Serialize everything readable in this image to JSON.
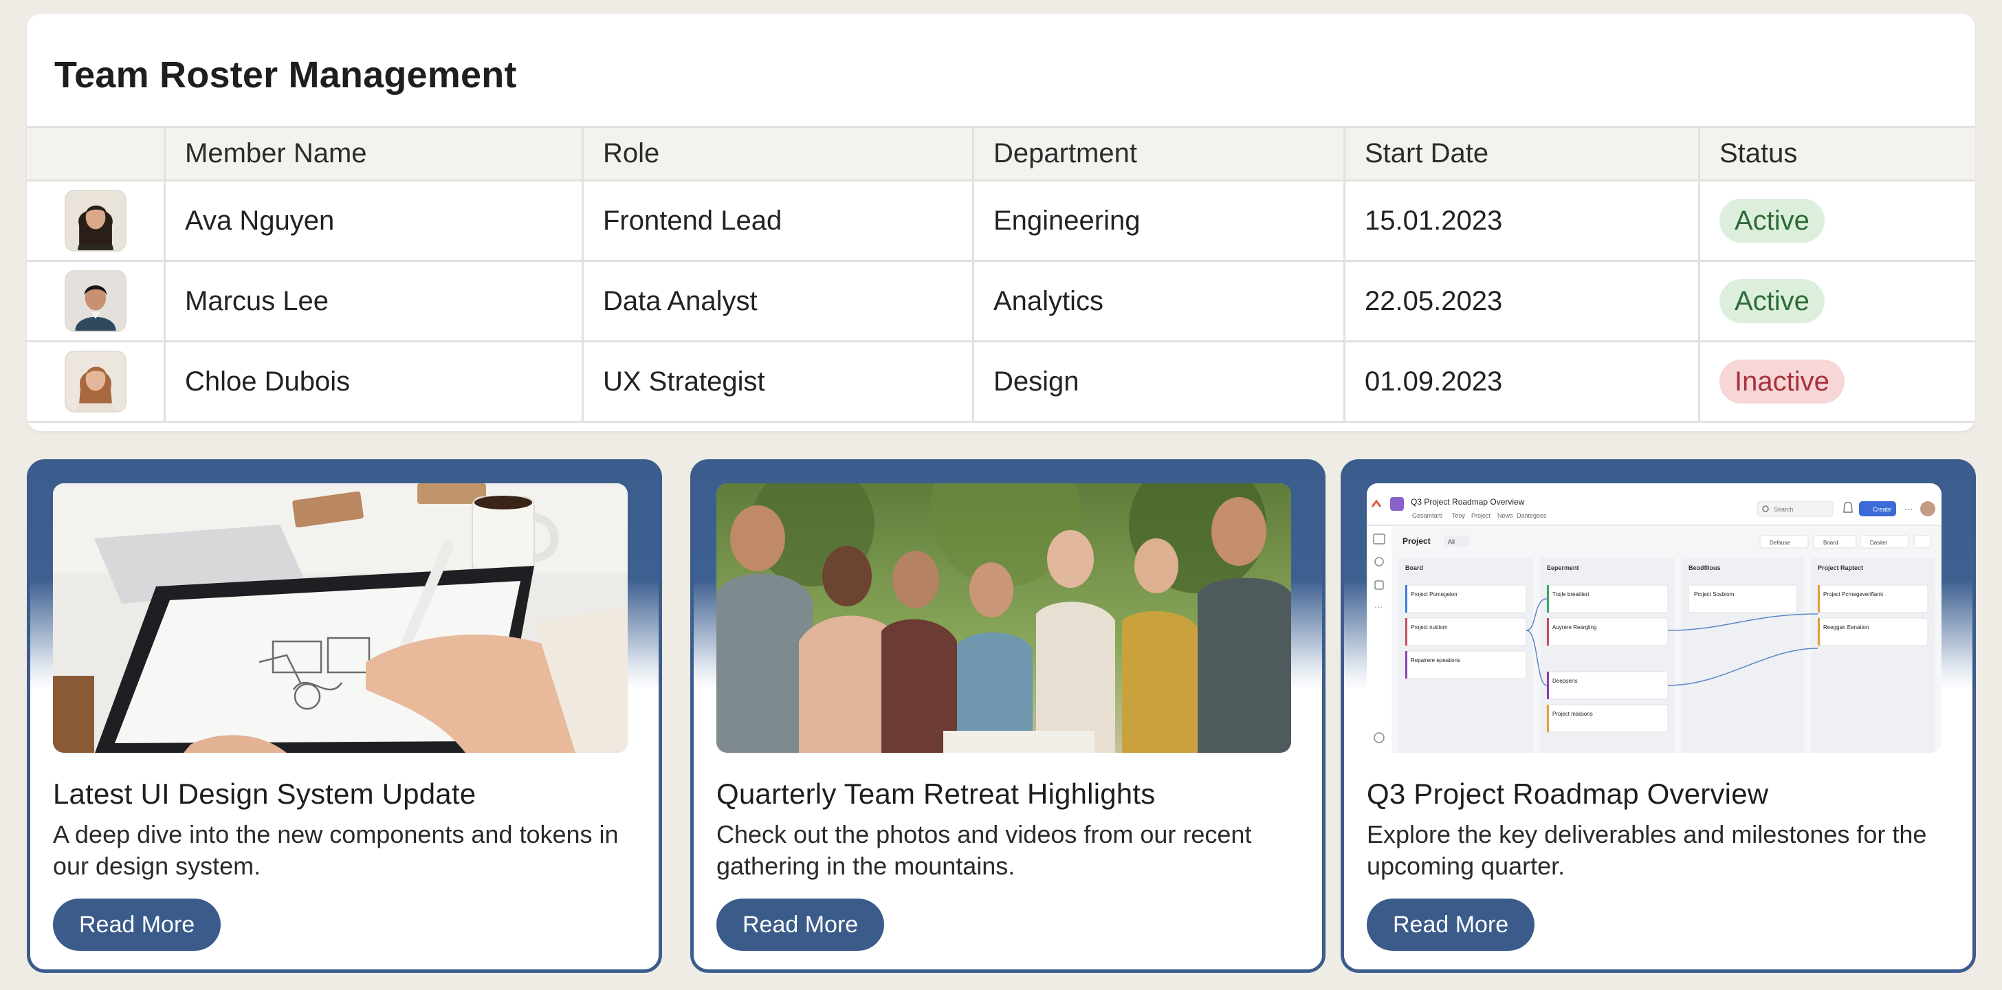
{
  "roster": {
    "title": "Team Roster Management",
    "columns": [
      "",
      "Member Name",
      "Role",
      "Department",
      "Start Date",
      "Status"
    ],
    "rows": [
      {
        "name": "Ava Nguyen",
        "role": "Frontend Lead",
        "department": "Engineering",
        "start_date": "15.01.2023",
        "status": "Active"
      },
      {
        "name": "Marcus Lee",
        "role": "Data Analyst",
        "department": "Analytics",
        "start_date": "22.05.2023",
        "status": "Active"
      },
      {
        "name": "Chloe Dubois",
        "role": "UX Strategist",
        "department": "Design",
        "start_date": "01.09.2023",
        "status": "Inactive"
      }
    ]
  },
  "cards": [
    {
      "title": "Latest UI Design System Update",
      "description": "A deep dive into the new components and tokens in our design system.",
      "button": "Read More"
    },
    {
      "title": "Quarterly Team Retreat Highlights",
      "description": "Check out the photos and videos from our recent gathering in the mountains.",
      "button": "Read More"
    },
    {
      "title": "Q3 Project Roadmap Overview",
      "description": "Explore the key deliverables and milestones for the upcoming quarter.",
      "button": "Read More"
    }
  ],
  "roadmap_thumbnail": {
    "window_title": "Q3 Project Roadmap Overview",
    "tabs": [
      "Gesamtartl",
      "Teoy",
      "Project",
      "News",
      "Dantegoes"
    ],
    "search": "Search",
    "action": "Create",
    "toolbar_label": "Project",
    "filter": "All",
    "toolbar_buttons": [
      "Defause",
      "Board",
      "Dasiter"
    ],
    "columns": [
      {
        "title": "Board",
        "cards": [
          "Project Pomegeion",
          "Project nuttiom",
          "Repairere epeations"
        ]
      },
      {
        "title": "Eeperment",
        "cards": [
          "Trojle breattlert",
          "Auyrere Reargling",
          "Deepoens",
          "Project maisions"
        ]
      },
      {
        "title": "Beodfilous",
        "cards": [
          "Project Sosbiom"
        ]
      },
      {
        "title": "Project Raptect",
        "cards": [
          "Project Pcrnegeveriflamt",
          "Reeggan Eenation"
        ]
      }
    ]
  },
  "colors": {
    "accent": "#3b5b8b",
    "active_bg": "#dcefdc",
    "active_text": "#2e6b37",
    "inactive_bg": "#f6d6d6",
    "inactive_text": "#a8313a",
    "page_bg": "#efece6"
  }
}
